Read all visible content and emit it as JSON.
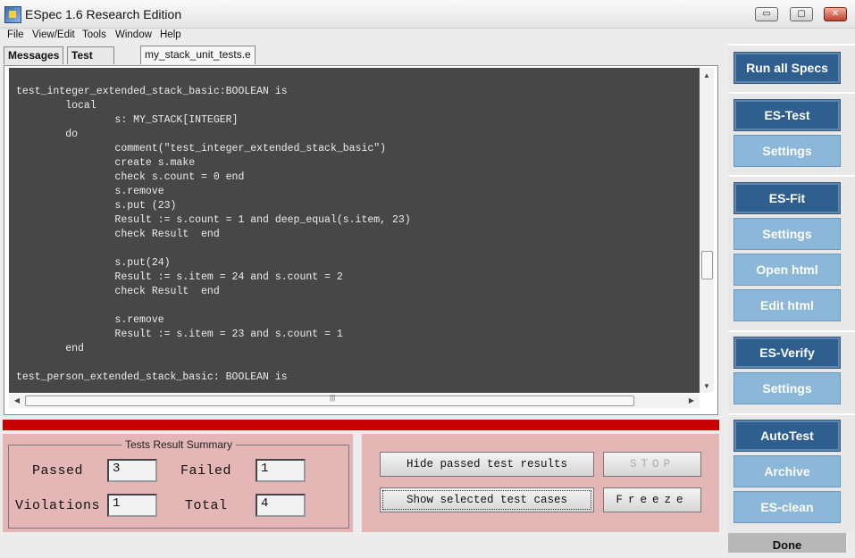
{
  "window": {
    "title": "ESpec 1.6 Research Edition",
    "controls": {
      "minimize": "▭",
      "maximize": "▢",
      "close": "✕"
    }
  },
  "menu": [
    "File",
    "View/Edit",
    "Tools",
    "Window",
    "Help"
  ],
  "tabs": [
    "Messages",
    "Test Results",
    "my_stack_unit_tests.e"
  ],
  "editor": {
    "lines": [
      "test_integer_extended_stack_basic:BOOLEAN is",
      "        local",
      "                s: MY_STACK[INTEGER]",
      "        do",
      "                comment(\"test_integer_extended_stack_basic\")",
      "                create s.make",
      "                check s.count = 0 end",
      "                s.remove",
      "                s.put (23)",
      "                Result := s.count = 1 and deep_equal(s.item, 23)",
      "                check Result  end",
      "",
      "                s.put(24)",
      "                Result := s.item = 24 and s.count = 2",
      "                check Result  end",
      "",
      "                s.remove",
      "                Result := s.item = 23 and s.count = 1",
      "        end",
      "",
      "test_person_extended_stack_basic: BOOLEAN is"
    ]
  },
  "progress": {
    "color": "#c80000",
    "fraction": 1.0
  },
  "summary": {
    "title": "Tests Result Summary",
    "passed_label": "Passed",
    "passed_value": "3",
    "failed_label": "Failed",
    "failed_value": "1",
    "violations_label": "Violations",
    "violations_value": "1",
    "total_label": "Total",
    "total_value": "4"
  },
  "actions": {
    "hide_passed": "Hide passed test results",
    "stop": "STOP",
    "show_selected": "Show selected test cases",
    "freeze": "Freeze"
  },
  "sidebar": {
    "run_all": "Run all Specs",
    "es_test": "ES-Test",
    "es_test_settings": "Settings",
    "es_fit": "ES-Fit",
    "es_fit_settings": "Settings",
    "open_html": "Open html",
    "edit_html": "Edit html",
    "es_verify": "ES-Verify",
    "es_verify_settings": "Settings",
    "autotest": "AutoTest",
    "archive": "Archive",
    "es_clean": "ES-clean"
  },
  "status": "Done",
  "colors": {
    "dark_button": "#2f5f8f",
    "light_button": "#8bb7d8",
    "panel": "#e4b6b6",
    "editor_bg": "#474747"
  }
}
